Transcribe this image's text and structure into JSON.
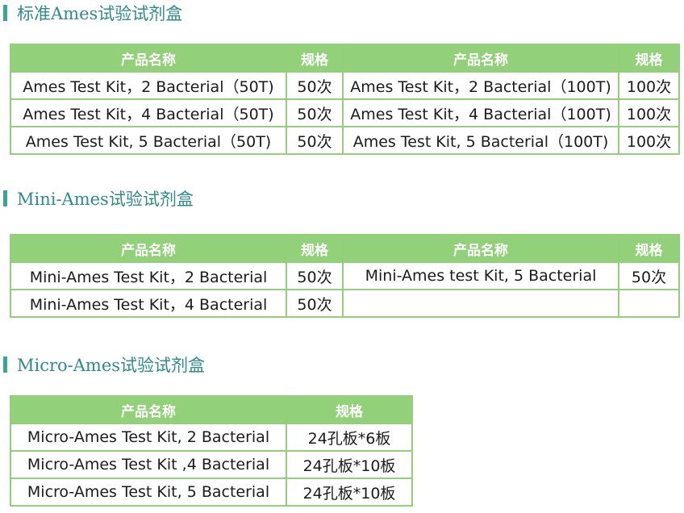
{
  "sections": [
    {
      "title": "标准Ames试验试剂盒",
      "headers": [
        "产品名称",
        "规格",
        "产品名称",
        "规格"
      ],
      "rows": [
        [
          "Ames Test Kit，2 Bacterial（50T)",
          "50次",
          "Ames Test Kit，2 Bacterial（100T)",
          "100次"
        ],
        [
          "Ames Test Kit，4 Bacterial（50T)",
          "50次",
          "Ames Test Kit，4 Bacterial（100T)",
          "100次"
        ],
        [
          "Ames Test Kit, 5 Bacterial（50T)",
          "50次",
          "Ames Test Kit, 5 Bacterial（100T)",
          "100次"
        ]
      ]
    },
    {
      "title": "Mini-Ames试验试剂盒",
      "headers": [
        "产品名称",
        "规格",
        "产品名称",
        "规格"
      ],
      "rows": [
        [
          "Mini-Ames Test Kit，2 Bacterial",
          "50次",
          "Mini-Ames test Kit, 5 Bacterial",
          "50次"
        ],
        [
          "Mini-Ames Test Kit，4 Bacterial",
          "50次",
          "",
          ""
        ]
      ]
    },
    {
      "title": "Micro-Ames试验试剂盒",
      "headers": [
        "产品名称",
        "规格"
      ],
      "rows": [
        [
          "Micro-Ames Test Kit, 2 Bacterial",
          "24孔板*6板"
        ],
        [
          "Micro-Ames Test Kit ,4 Bacterial",
          "24孔板*10板"
        ],
        [
          "Micro-Ames Test Kit, 5 Bacterial",
          "24孔板*10板"
        ]
      ]
    }
  ],
  "colors": {
    "header_bg": "#92d07a",
    "border": "#94cd7c",
    "title_text": "#2f8a8a",
    "title_bar": "#3aa796"
  }
}
